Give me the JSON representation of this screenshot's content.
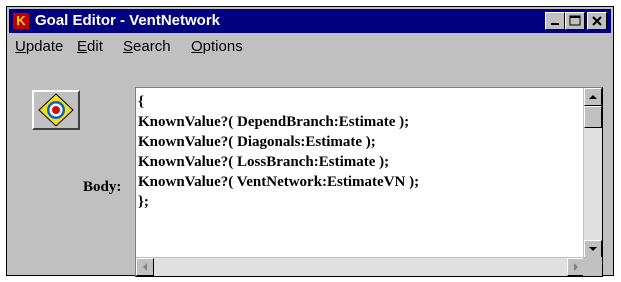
{
  "window": {
    "title": "Goal Editor - VentNetwork",
    "app_icon": "K",
    "controls": [
      "minimize-icon",
      "maximize-icon",
      "close-icon"
    ]
  },
  "menu": {
    "items": [
      {
        "label": "Update",
        "mnemonic": "U"
      },
      {
        "label": "Edit",
        "mnemonic": "E"
      },
      {
        "label": "Search",
        "mnemonic": "S"
      },
      {
        "label": "Options",
        "mnemonic": "O"
      }
    ]
  },
  "goal_button": {
    "icon": "target-icon"
  },
  "body_field": {
    "label": "Body:",
    "lines": [
      "{",
      "KnownValue?( DependBranch:Estimate );",
      "KnownValue?( Diagonals:Estimate );",
      "KnownValue?( LossBranch:Estimate );",
      "KnownValue?( VentNetwork:EstimateVN );",
      "};"
    ]
  },
  "colors": {
    "titlebar": "#000080",
    "face": "#c0c0c0",
    "editor_bg": "#ffffff"
  }
}
